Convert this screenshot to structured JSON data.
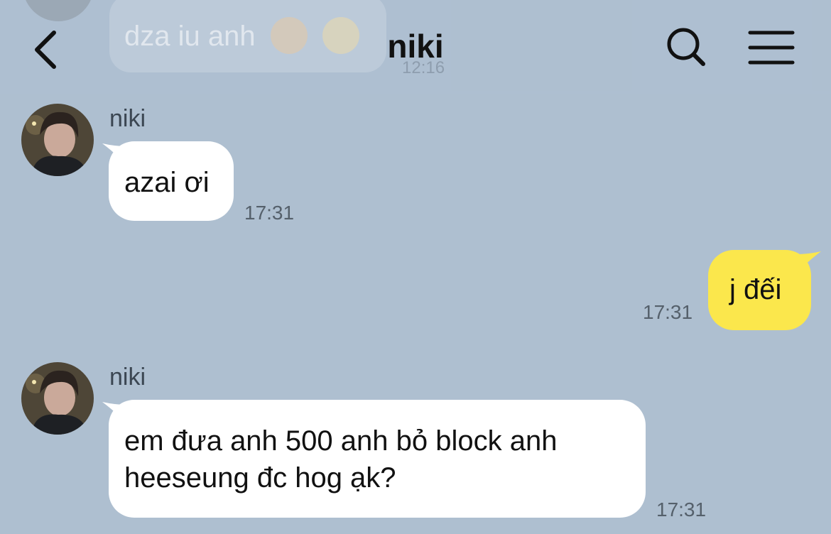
{
  "header": {
    "title": "niki",
    "back_icon": "chevron-left-icon",
    "search_icon": "search-icon",
    "menu_icon": "hamburger-menu-icon"
  },
  "previous_message": {
    "text": "dza iu anh",
    "emojis": [
      "smiling-face-with-hearts",
      "heart-eyes-face"
    ],
    "time": "12:16"
  },
  "messages": [
    {
      "direction": "incoming",
      "sender": "niki",
      "text": "azai ơi",
      "time": "17:31"
    },
    {
      "direction": "outgoing",
      "text": "j đếi",
      "time": "17:31"
    },
    {
      "direction": "incoming",
      "sender": "niki",
      "lines": [
        "em đưa anh 500 anh bỏ block anh",
        "heeseung đc hog ạk?"
      ],
      "time": "17:31"
    }
  ],
  "colors": {
    "background": "#aebfd0",
    "incoming_bubble": "#ffffff",
    "outgoing_bubble": "#fbe74c",
    "text": "#111111",
    "timestamp": "#55606b"
  }
}
